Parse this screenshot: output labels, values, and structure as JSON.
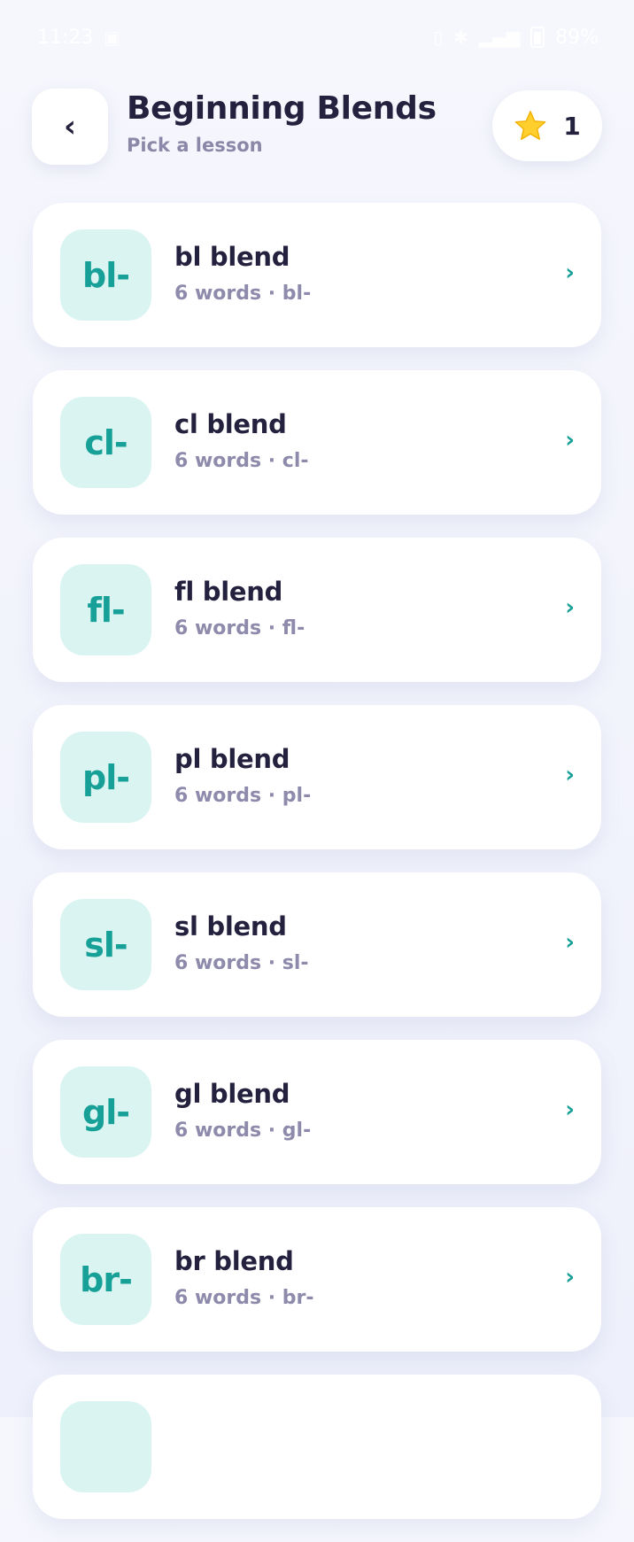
{
  "status_bar": {
    "time": "11:23",
    "battery": "89%"
  },
  "header": {
    "back_icon": "chevron-left",
    "title": "Beginning Blends",
    "subtitle": "Pick a lesson",
    "stars_icon": "star",
    "stars_count": "1"
  },
  "lessons": [
    {
      "badge": "bl-",
      "title": "bl blend",
      "subtitle": "6 words · bl-"
    },
    {
      "badge": "cl-",
      "title": "cl blend",
      "subtitle": "6 words · cl-"
    },
    {
      "badge": "fl-",
      "title": "fl blend",
      "subtitle": "6 words · fl-"
    },
    {
      "badge": "pl-",
      "title": "pl blend",
      "subtitle": "6 words · pl-"
    },
    {
      "badge": "sl-",
      "title": "sl blend",
      "subtitle": "6 words · sl-"
    },
    {
      "badge": "gl-",
      "title": "gl blend",
      "subtitle": "6 words · gl-"
    },
    {
      "badge": "br-",
      "title": "br blend",
      "subtitle": "6 words · br-"
    },
    {
      "badge": "",
      "title": "",
      "subtitle": ""
    }
  ],
  "colors": {
    "accent": "#17a097",
    "badge_bg": "#d9f4f1",
    "text_primary": "#24213f",
    "text_secondary": "#8d8aab"
  }
}
